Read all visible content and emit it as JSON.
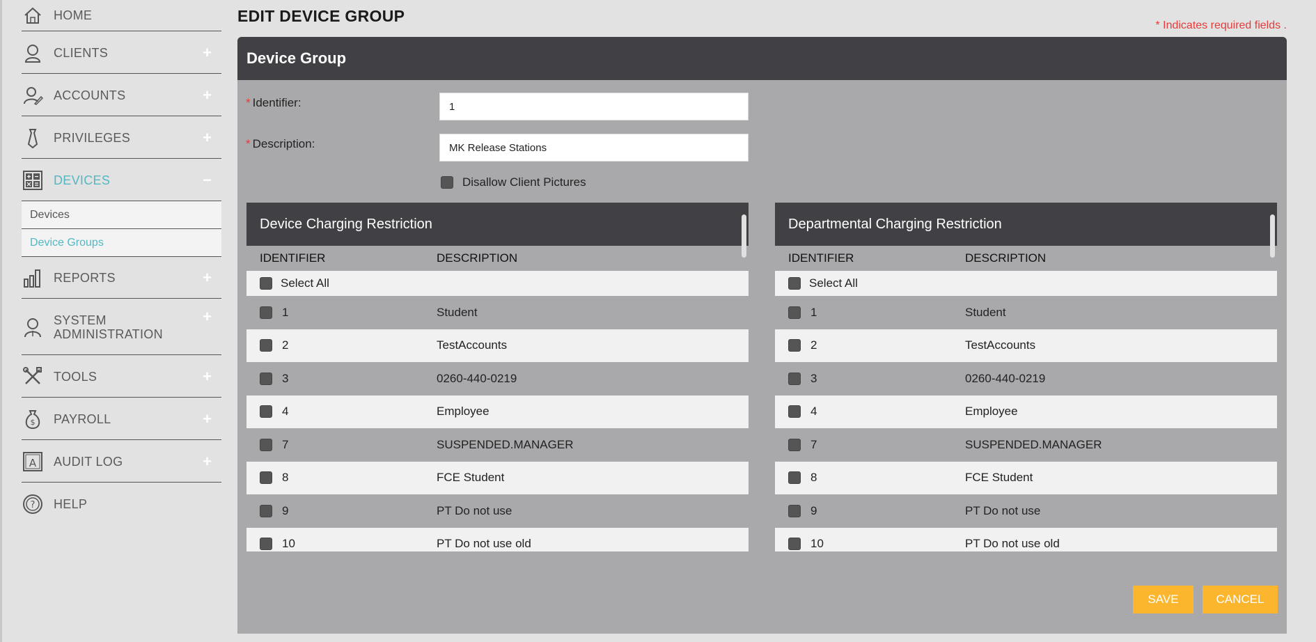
{
  "sidebar": {
    "items": [
      {
        "label": "HOME",
        "icon": "home-icon"
      },
      {
        "label": "CLIENTS",
        "icon": "client-icon",
        "expand": "+"
      },
      {
        "label": "ACCOUNTS",
        "icon": "accounts-icon",
        "expand": "+"
      },
      {
        "label": "PRIVILEGES",
        "icon": "tie-icon",
        "expand": "+"
      },
      {
        "label": "DEVICES",
        "icon": "devices-icon",
        "expand": "−"
      },
      {
        "label": "REPORTS",
        "icon": "reports-icon",
        "expand": "+"
      },
      {
        "label": "SYSTEM ADMINISTRATION",
        "icon": "admin-icon",
        "expand": "+"
      },
      {
        "label": "TOOLS",
        "icon": "tools-icon",
        "expand": "+"
      },
      {
        "label": "PAYROLL",
        "icon": "money-bag-icon",
        "expand": "+"
      },
      {
        "label": "AUDIT LOG",
        "icon": "audit-icon",
        "expand": "+"
      },
      {
        "label": "HELP",
        "icon": "help-icon"
      }
    ],
    "sub_items": [
      {
        "label": "Devices"
      },
      {
        "label": "Device Groups"
      }
    ]
  },
  "page": {
    "title": "EDIT DEVICE GROUP",
    "required_note": "* Indicates required fields ."
  },
  "form": {
    "panel_title": "Device Group",
    "required_mark": "*",
    "identifier_label": "Identifier:",
    "identifier_value": "1",
    "description_label": "Description:",
    "description_value": "MK Release Stations",
    "disallow_label": "Disallow Client Pictures"
  },
  "device_restriction": {
    "title": "Device Charging Restriction",
    "col_identifier": "IDENTIFIER",
    "col_description": "DESCRIPTION",
    "select_all": "Select All",
    "rows": [
      {
        "id": "1",
        "desc": "Student"
      },
      {
        "id": "2",
        "desc": "TestAccounts"
      },
      {
        "id": "3",
        "desc": "0260-440-0219"
      },
      {
        "id": "4",
        "desc": "Employee"
      },
      {
        "id": "7",
        "desc": "SUSPENDED.MANAGER"
      },
      {
        "id": "8",
        "desc": "FCE Student"
      },
      {
        "id": "9",
        "desc": "PT Do not use"
      },
      {
        "id": "10",
        "desc": "PT Do not use old"
      }
    ]
  },
  "dept_restriction": {
    "title": "Departmental Charging Restriction",
    "col_identifier": "IDENTIFIER",
    "col_description": "DESCRIPTION",
    "select_all": "Select All",
    "rows": [
      {
        "id": "1",
        "desc": "Student"
      },
      {
        "id": "2",
        "desc": "TestAccounts"
      },
      {
        "id": "3",
        "desc": "0260-440-0219"
      },
      {
        "id": "4",
        "desc": "Employee"
      },
      {
        "id": "7",
        "desc": "SUSPENDED.MANAGER"
      },
      {
        "id": "8",
        "desc": "FCE Student"
      },
      {
        "id": "9",
        "desc": "PT Do not use"
      },
      {
        "id": "10",
        "desc": "PT Do not use old"
      }
    ]
  },
  "buttons": {
    "save": "SAVE",
    "cancel": "CANCEL"
  },
  "colors": {
    "accent": "#53b8c2",
    "header_dark": "#404045",
    "button": "#fbb62d",
    "required": "#e53b3b"
  }
}
